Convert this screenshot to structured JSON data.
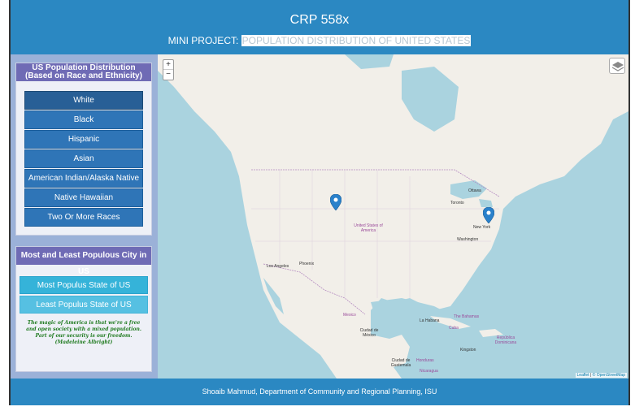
{
  "header": {
    "title": "CRP 558x",
    "subtitle_prefix": "MINI PROJECT: ",
    "subtitle_highlight": "POPULATION DISTRIBUTION OF UNITED STATES"
  },
  "race_panel": {
    "heading": "US Population Distribution (Based on Race and Ethnicity)",
    "buttons": [
      "White",
      "Black",
      "Hispanic",
      "Asian",
      "American Indian/Alaska Native",
      "Native Hawaiian",
      "Two Or More Races"
    ],
    "active_index": 0
  },
  "city_panel": {
    "heading": "Most and Least Populous City in US",
    "most_button": "Most Populus State of US",
    "least_button": "Least Populus State of US",
    "quote": "The magic of America is that we're a free and open society with a mixed population. Part of our security is our freedom.(Madeleine Albright)"
  },
  "map": {
    "zoom_in": "+",
    "zoom_out": "−",
    "attribution_leaflet": "Leaflet",
    "attribution_osm": "© OpenStreetMap",
    "labels": {
      "country_us": "United States of America",
      "mexico": "Mexico",
      "ottawa": "Ottawa",
      "toronto": "Toronto",
      "new_york": "New York",
      "washington": "Washington",
      "los_angeles": "Los Angeles",
      "phoenix": "Phoenix",
      "la_habana": "La Habana",
      "cuba": "Cuba",
      "the_bahamas": "The Bahamas",
      "ciudad_de_mexico": "Ciudad de México",
      "ciudad_de_guatemala": "Ciudad de Guatemala",
      "honduras": "Honduras",
      "nicaragua": "Nicaragua",
      "kingston": "Kingston",
      "republica_dominicana": "República Dominicana"
    },
    "colors": {
      "water": "#aad3df",
      "land": "#f2efe9",
      "marker": "#2a81cb"
    }
  },
  "footer": {
    "text": "Shoaib Mahmud, Department of Community and Regional Planning, ISU"
  }
}
